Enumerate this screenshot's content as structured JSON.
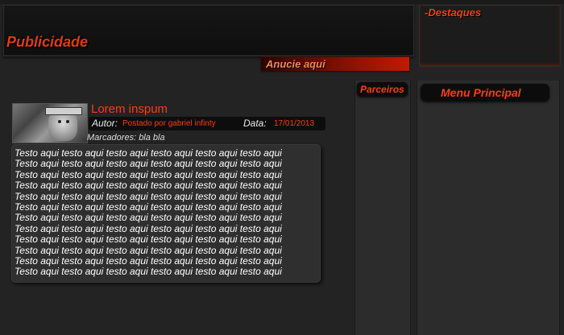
{
  "header": {
    "banner_title": "Publicidade",
    "ad_button_label": "Anucie aqui",
    "highlights_title": "-Destaques"
  },
  "sidebar": {
    "partners_title": "Parceiros",
    "main_menu_title": "Menu Principal"
  },
  "post": {
    "title": "Lorem inspum",
    "author_label": "Autor:",
    "author_value": "Postado por gabriel infinty",
    "date_label": "Data:",
    "date_value": "17/01/2013",
    "tags": "Marcadores: bla bla",
    "body": "Testo aqui testo aqui testo aqui testo aqui testo aqui testo aqui\nTesto aqui testo aqui testo aqui testo aqui testo aqui testo aqui\nTesto aqui testo aqui testo aqui testo aqui testo aqui testo aqui\nTesto aqui testo aqui testo aqui testo aqui testo aqui testo aqui\nTesto aqui testo aqui testo aqui testo aqui testo aqui testo aqui\nTesto aqui testo aqui testo aqui testo aqui testo aqui testo aqui\nTesto aqui testo aqui testo aqui testo aqui testo aqui testo aqui\nTesto aqui testo aqui testo aqui testo aqui testo aqui testo aqui\nTesto aqui testo aqui testo aqui testo aqui testo aqui testo aqui\nTesto aqui testo aqui testo aqui testo aqui testo aqui testo aqui\nTesto aqui testo aqui testo aqui testo aqui testo aqui testo aqui\nTesto aqui testo aqui testo aqui testo aqui testo aqui testo aqui"
  },
  "colors": {
    "accent": "#ff3a10",
    "background": "#232323",
    "panel": "#2c2c2c"
  }
}
